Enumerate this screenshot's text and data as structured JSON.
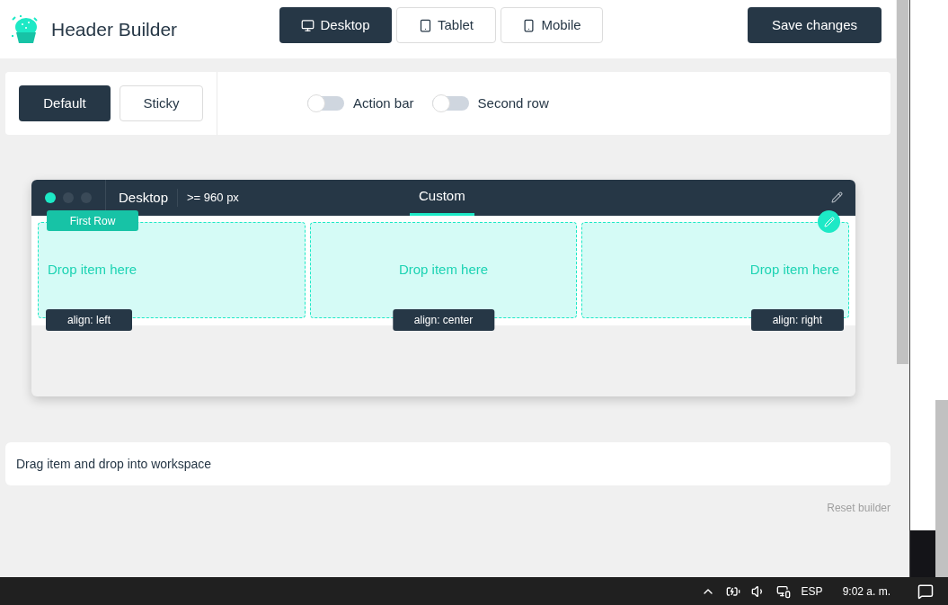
{
  "header": {
    "title": "Header Builder",
    "devices": [
      {
        "kind": "desktop",
        "label": "Desktop",
        "selected": true
      },
      {
        "kind": "tablet",
        "label": "Tablet",
        "selected": false
      },
      {
        "kind": "mobile",
        "label": "Mobile",
        "selected": false
      }
    ],
    "save": "Save changes"
  },
  "modes": [
    {
      "label": "Default",
      "selected": true
    },
    {
      "label": "Sticky",
      "selected": false
    }
  ],
  "toggles": [
    {
      "label": "Action bar",
      "on": false
    },
    {
      "label": "Second row",
      "on": false
    }
  ],
  "preview": {
    "dots": [
      {
        "color": "#1de9c6"
      },
      {
        "color": "#3a4a58"
      },
      {
        "color": "#3a4a58"
      }
    ],
    "device": "Desktop",
    "width": ">= 960 px",
    "tabs": [
      {
        "label": "Custom",
        "selected": true
      }
    ],
    "row_label": "First Row",
    "columns": [
      {
        "kind": "left",
        "drop": "Drop item here",
        "align": "align: left"
      },
      {
        "kind": "center",
        "drop": "Drop item here",
        "align": "align: center"
      },
      {
        "kind": "right",
        "drop": "Drop item here",
        "align": "align: right"
      }
    ]
  },
  "hint": "Drag item and drop into workspace",
  "reset": "Reset builder",
  "taskbar": {
    "language": "ESP",
    "time": "9:02 a. m."
  }
}
